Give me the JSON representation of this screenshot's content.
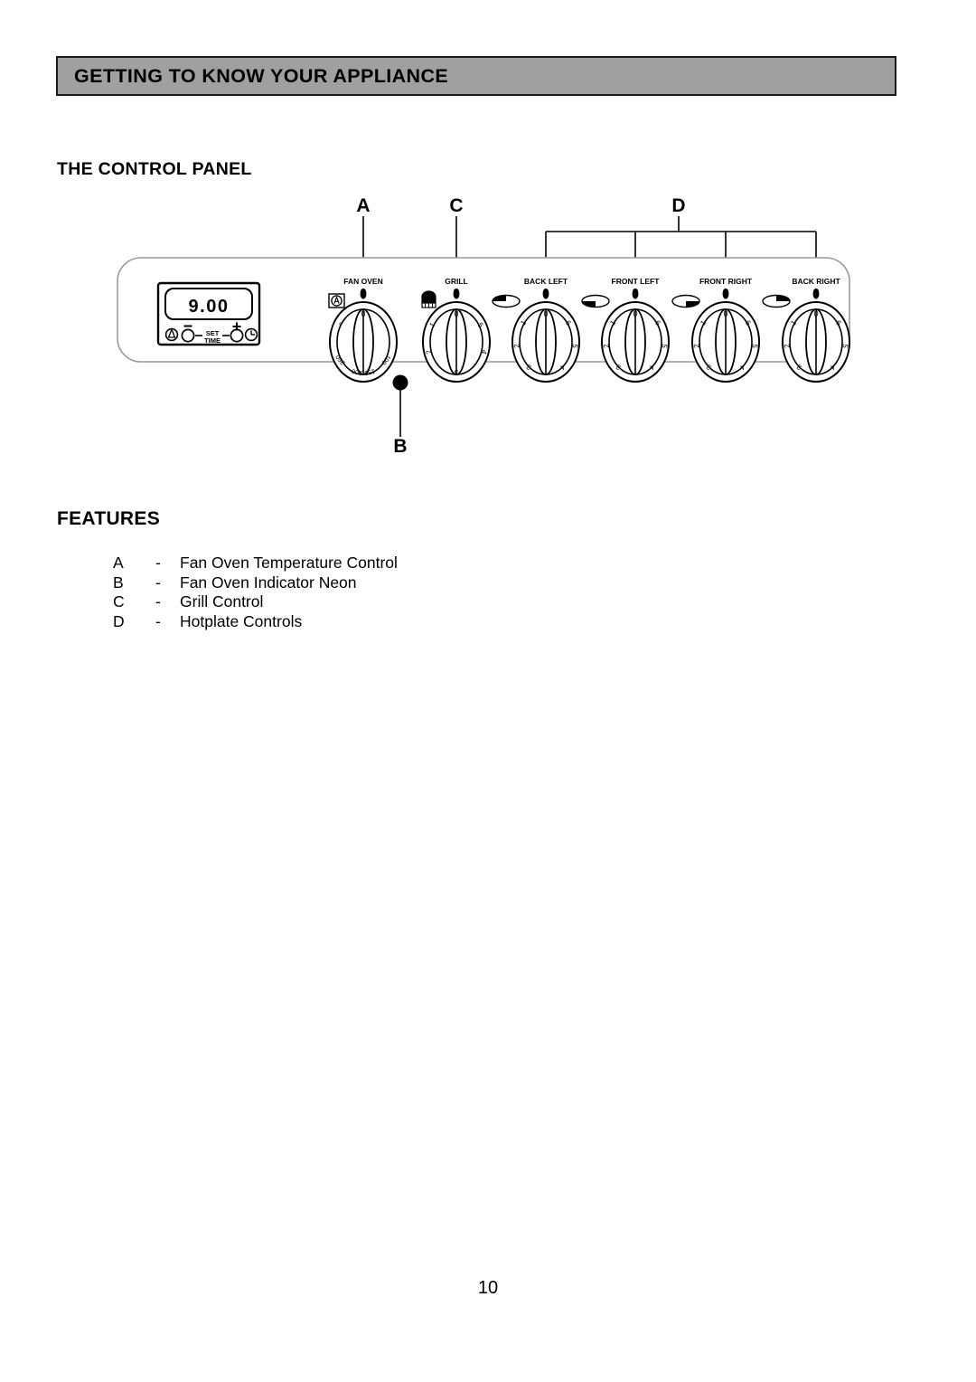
{
  "header": {
    "title": "GETTING TO KNOW YOUR APPLIANCE"
  },
  "sections": {
    "control_panel_heading": "THE CONTROL PANEL",
    "features_heading": "FEATURES"
  },
  "diagram": {
    "callouts": [
      {
        "id": "A",
        "label": "A",
        "target": "fan-oven-knob"
      },
      {
        "id": "B",
        "label": "B",
        "target": "fan-oven-indicator-neon"
      },
      {
        "id": "C",
        "label": "C",
        "target": "grill-knob"
      },
      {
        "id": "D",
        "label": "D",
        "target": "hotplate-knobs"
      }
    ],
    "timer": {
      "display_value": "9.00",
      "separator": "°",
      "set_time_label_line1": "SET",
      "set_time_label_line2": "TIME",
      "minus_label": "–",
      "plus_label": "+",
      "bell_icon": "minute-minder-bell-icon",
      "clock_icon": "clock-icon"
    },
    "knobs": [
      {
        "name": "fan-oven-knob",
        "label": "FAN OVEN",
        "off_mark": "0",
        "scale": [
          "0",
          "50",
          "100",
          "150",
          "200",
          "250"
        ],
        "left_icon": "circled-a-auto-icon",
        "right_icon": null
      },
      {
        "name": "grill-knob",
        "label": "GRILL",
        "off_mark": "0",
        "scale": [
          "0",
          "1",
          "2",
          "3",
          "4",
          "5"
        ],
        "left_icon": "grill-element-icon",
        "right_icon": null
      },
      {
        "name": "back-left-hotplate-knob",
        "label": "BACK LEFT",
        "off_mark": "0",
        "scale": [
          "0",
          "1",
          "2",
          "3",
          "4",
          "5",
          "6"
        ],
        "left_icon": "hob-back-left-icon",
        "right_icon": null
      },
      {
        "name": "front-left-hotplate-knob",
        "label": "FRONT LEFT",
        "off_mark": "0",
        "scale": [
          "0",
          "1",
          "2",
          "3",
          "4",
          "5",
          "6"
        ],
        "left_icon": "hob-front-left-icon",
        "right_icon": null
      },
      {
        "name": "front-right-hotplate-knob",
        "label": "FRONT RIGHT",
        "off_mark": "0",
        "scale": [
          "0",
          "1",
          "2",
          "3",
          "4",
          "5",
          "6"
        ],
        "left_icon": "hob-front-right-icon",
        "right_icon": null
      },
      {
        "name": "back-right-hotplate-knob",
        "label": "BACK RIGHT",
        "off_mark": "0",
        "scale": [
          "0",
          "1",
          "2",
          "3",
          "4",
          "5",
          "6"
        ],
        "left_icon": "hob-back-right-icon",
        "right_icon": null
      }
    ]
  },
  "features": [
    {
      "key": "A",
      "dash": "-",
      "label": "Fan Oven Temperature Control"
    },
    {
      "key": "B",
      "dash": "-",
      "label": "Fan Oven Indicator Neon"
    },
    {
      "key": "C",
      "dash": "-",
      "label": "Grill Control"
    },
    {
      "key": "D",
      "dash": "-",
      "label": "Hotplate Controls"
    }
  ],
  "footer": {
    "page_number": "10"
  },
  "colors": {
    "header_background": "#a0a0a0",
    "header_border": "#1a1a1a",
    "ink": "#000000",
    "panel_outline": "#9a9a9a",
    "page_background": "#ffffff"
  }
}
